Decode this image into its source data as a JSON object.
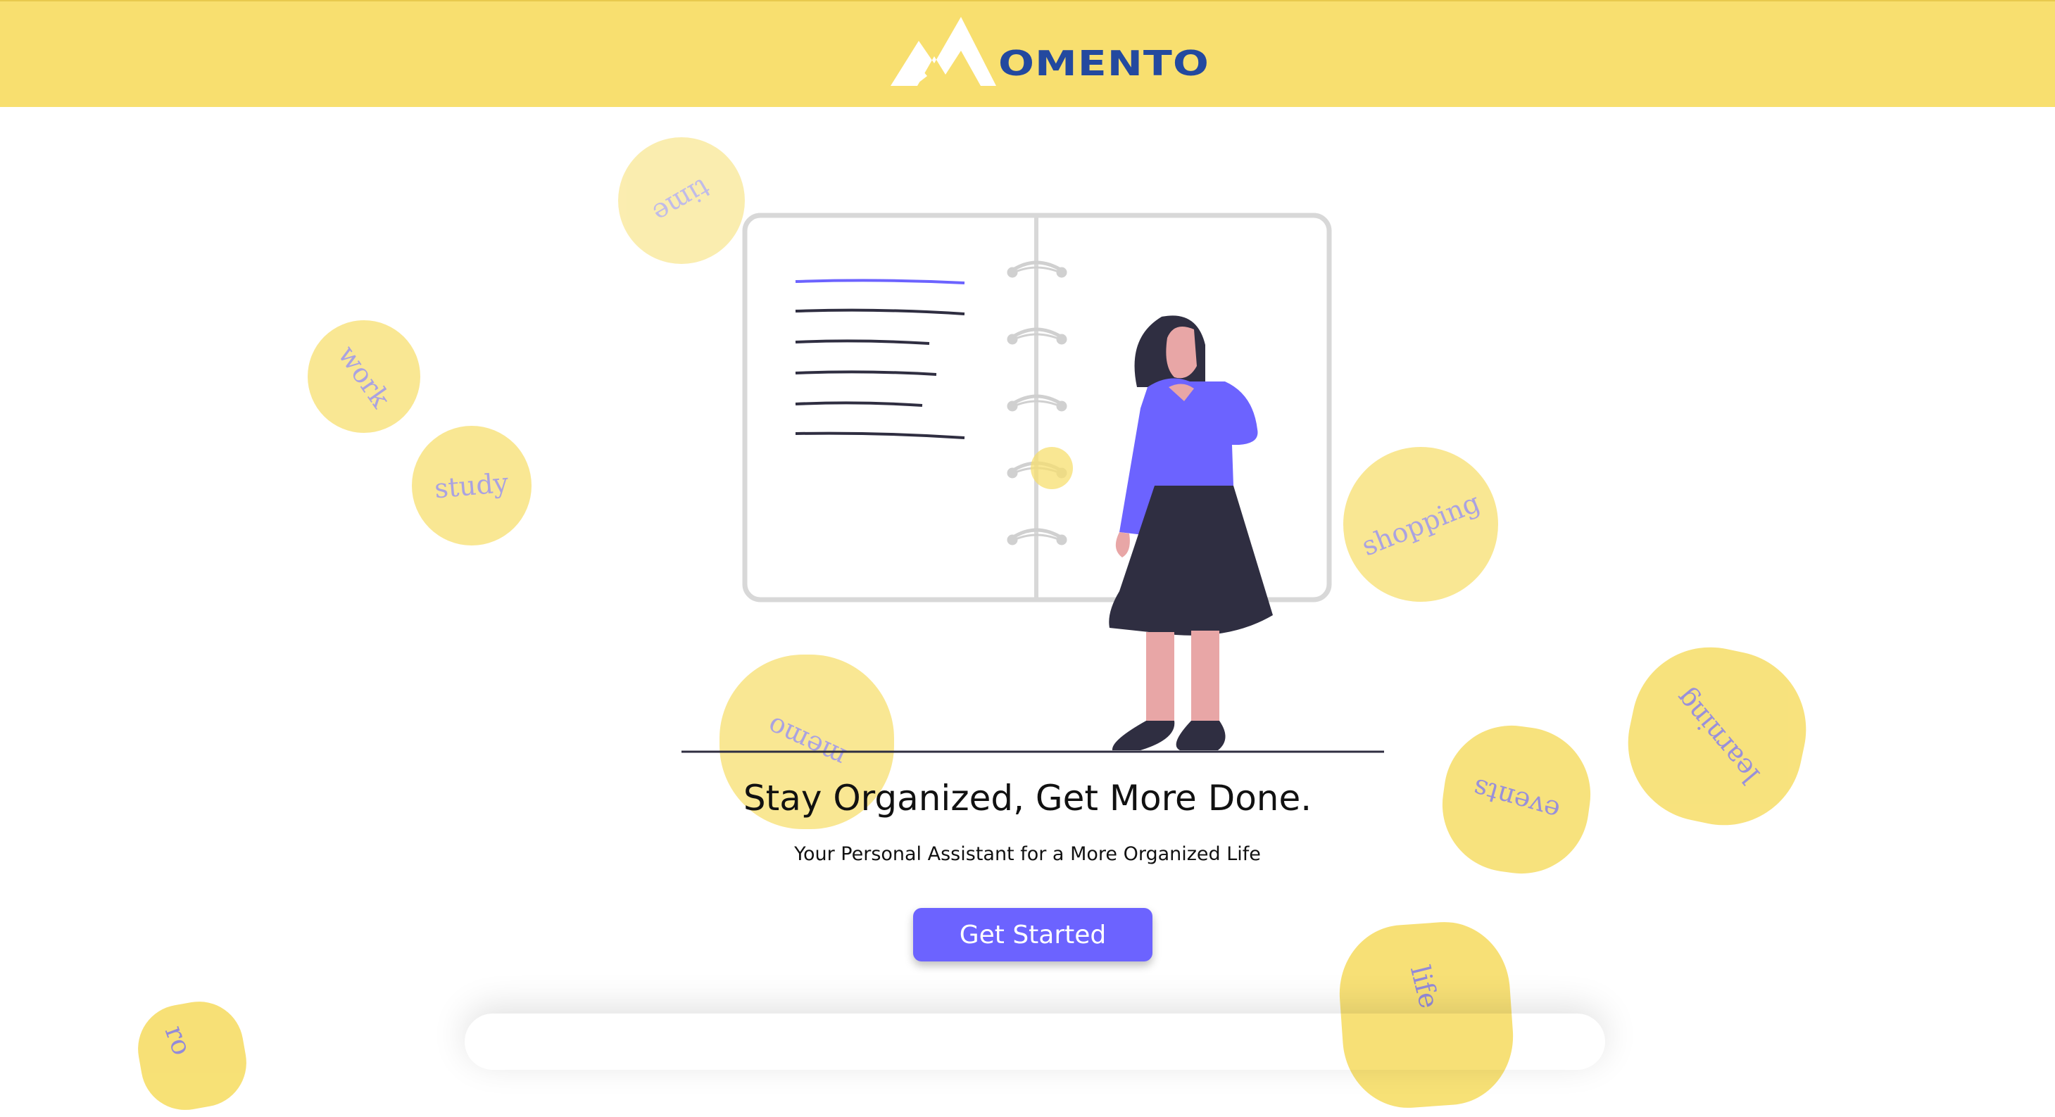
{
  "brand": {
    "logo_text": "OMENTO",
    "colors": {
      "header_bg": "#f8df6f",
      "logo_text": "#23499f",
      "accent": "#6c63ff"
    }
  },
  "bubbles": [
    {
      "label": "time"
    },
    {
      "label": "work"
    },
    {
      "label": "study"
    },
    {
      "label": "shopping"
    },
    {
      "label": "memo"
    },
    {
      "label": "events"
    },
    {
      "label": "learning"
    },
    {
      "label": "life"
    },
    {
      "label": "ro"
    }
  ],
  "hero": {
    "headline": "Stay Organized, Get More Done.",
    "subheadline": "Your Personal Assistant for a More Organized Life",
    "cta_label": "Get Started"
  },
  "icons": [
    "logo-mountain-icon",
    "notebook-woman-illustration"
  ]
}
